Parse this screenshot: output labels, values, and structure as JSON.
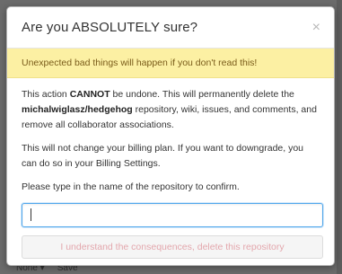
{
  "modal": {
    "title": "Are you ABSOLUTELY sure?",
    "close_glyph": "×",
    "warning": "Unexpected bad things will happen if you don't read this!",
    "para1_pre": "This action ",
    "para1_cannot": "CANNOT",
    "para1_mid": " be undone. This will permanently delete the ",
    "repo_name": "michalwiglasz/hedgehog",
    "para1_post": " repository, wiki, issues, and comments, and remove all collaborator associations.",
    "para2": "This will not change your billing plan. If you want to downgrade, you can do so in your Billing Settings.",
    "para3": "Please type in the name of the repository to confirm.",
    "input_value": "",
    "confirm_button": "I understand the consequences, delete this repository"
  },
  "backdrop": {
    "left_fragment": "None ▾",
    "right_fragment": "Save"
  },
  "colors": {
    "warning_bg": "#fcf0a3",
    "warning_text": "#7a5c1a",
    "input_focus": "#52a8ec",
    "danger_text_disabled": "#e3a7ad"
  }
}
